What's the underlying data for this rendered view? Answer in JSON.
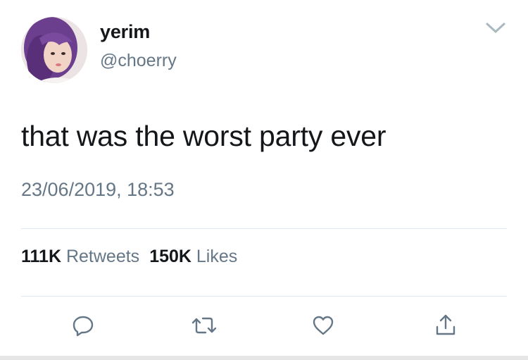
{
  "user": {
    "display_name": "yerim",
    "handle": "@choerry"
  },
  "tweet": {
    "text": "that was the worst party ever",
    "timestamp": "23/06/2019, 18:53"
  },
  "stats": {
    "retweets_count": "111K",
    "retweets_label": "Retweets",
    "likes_count": "150K",
    "likes_label": "Likes"
  },
  "icons": {
    "more": "chevron-down-icon",
    "reply": "reply-icon",
    "retweet": "retweet-icon",
    "like": "heart-icon",
    "share": "share-icon"
  },
  "colors": {
    "text_primary": "#14171a",
    "text_secondary": "#657786",
    "icon": "#657786",
    "divider": "#e1e8ed"
  }
}
